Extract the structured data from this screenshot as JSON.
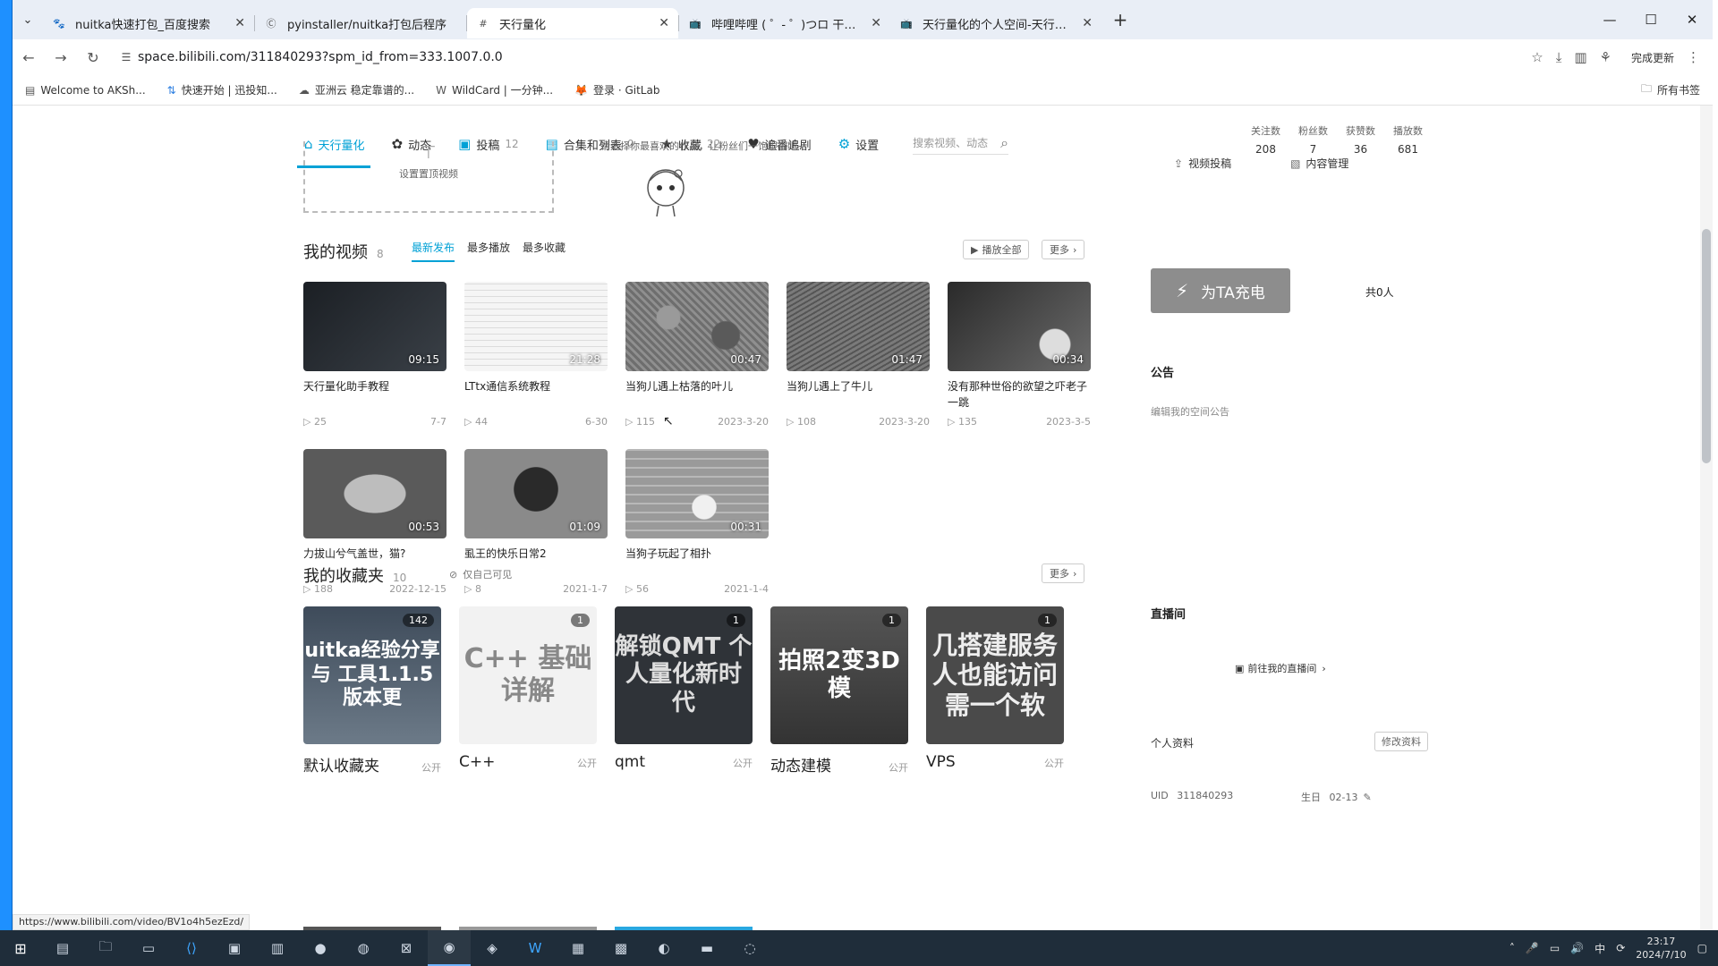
{
  "browser": {
    "tabs": [
      {
        "title": "nuitka快速打包_百度搜索",
        "icon": "paw-icon",
        "active": false
      },
      {
        "title": "pyinstaller/nuitka打包后程序",
        "icon": "c-icon",
        "active": false
      },
      {
        "title": "天行量化",
        "icon": "hash-icon",
        "active": true
      },
      {
        "title": "哔哩哔哩 ( ゜- ゜)つロ 干杯~-bi",
        "icon": "bilibili-icon",
        "active": false
      },
      {
        "title": "天行量化的个人空间-天行量化",
        "icon": "bilibili-icon",
        "active": false
      }
    ],
    "url": "space.bilibili.com/311840293?spm_id_from=333.1007.0.0",
    "update_label": "完成更新",
    "bookmarks": [
      "Welcome to AKSh...",
      "快速开始 | 迅投知...",
      "亚洲云 稳定靠谱的...",
      "WildCard | 一分钟...",
      "登录 · GitLab"
    ],
    "all_bookmarks": "所有书签"
  },
  "space": {
    "nav": [
      {
        "label": "天行量化",
        "count": "",
        "icon": "home-icon",
        "active": true
      },
      {
        "label": "动态",
        "count": "",
        "icon": "dynamic-icon"
      },
      {
        "label": "投稿",
        "count": "12",
        "icon": "upload-icon"
      },
      {
        "label": "合集和列表",
        "count": "0",
        "icon": "collection-icon"
      },
      {
        "label": "收藏",
        "count": "22",
        "icon": "favorite-icon"
      },
      {
        "label": "追番追剧",
        "count": "",
        "icon": "heart-icon"
      },
      {
        "label": "设置",
        "count": "",
        "icon": "gear-icon"
      }
    ],
    "search_placeholder": "搜索视频、动态",
    "stats": [
      {
        "label": "关注数",
        "value": "208"
      },
      {
        "label": "粉丝数",
        "value": "7"
      },
      {
        "label": "获赞数",
        "value": "36"
      },
      {
        "label": "播放数",
        "value": "681"
      }
    ],
    "top_video_label": "设置置顶视频",
    "top_hint": "请选择你最喜欢的作品，让粉丝们一饱眼福吧~",
    "right_links": [
      "视频投稿",
      "内容管理"
    ],
    "charge_label": "为TA充电",
    "charge_count": "共0人",
    "notice_title": "公告",
    "notice_text": "编辑我的空间公告",
    "live_title": "直播间",
    "live_link": "前往我的直播间",
    "profile_title": "个人资料",
    "profile_edit": "修改资料",
    "uid_label": "UID",
    "uid": "311840293",
    "birthday_label": "生日",
    "birthday": "02-13"
  },
  "videos_section": {
    "title": "我的视频",
    "count": "8",
    "sorts": [
      "最新发布",
      "最多播放",
      "最多收藏"
    ],
    "play_all": "播放全部",
    "more": "更多",
    "videos": [
      {
        "title": "天行量化助手教程",
        "duration": "09:15",
        "plays": "25",
        "date": "7-7"
      },
      {
        "title": "LTtx通信系统教程",
        "duration": "21:28",
        "plays": "44",
        "date": "6-30"
      },
      {
        "title": "当狗儿遇上枯落的叶儿",
        "duration": "00:47",
        "plays": "115",
        "date": "2023-3-20"
      },
      {
        "title": "当狗儿遇上了牛儿",
        "duration": "01:47",
        "plays": "108",
        "date": "2023-3-20"
      },
      {
        "title": "没有那种世俗的欲望之吓老子一跳",
        "duration": "00:34",
        "plays": "135",
        "date": "2023-3-5"
      },
      {
        "title": "力拔山兮气盖世，猫?",
        "duration": "00:53",
        "plays": "188",
        "date": "2022-12-15"
      },
      {
        "title": "虱王的快乐日常2",
        "duration": "01:09",
        "plays": "8",
        "date": "2021-1-7"
      },
      {
        "title": "当狗子玩起了相扑",
        "duration": "00:31",
        "plays": "56",
        "date": "2021-1-4"
      }
    ]
  },
  "favs_section": {
    "title": "我的收藏夹",
    "count": "10",
    "privacy": "仅自己可见",
    "more": "更多",
    "folders": [
      {
        "name": "默认收藏夹",
        "count": "142",
        "visibility": "公开",
        "cover_text": "uitka经验分享 与 工具1.1.5版本更"
      },
      {
        "name": "C++",
        "count": "1",
        "visibility": "公开",
        "cover_text": "C++ 基础详解"
      },
      {
        "name": "qmt",
        "count": "1",
        "visibility": "公开",
        "cover_text": "解锁QMT 个人量化新时代"
      },
      {
        "name": "动态建模",
        "count": "1",
        "visibility": "公开",
        "cover_text": "拍照2变3D模"
      },
      {
        "name": "VPS",
        "count": "1",
        "visibility": "公开",
        "cover_text": "几搭建服务 人也能访问 需一个软"
      }
    ]
  },
  "status_url": "https://www.bilibili.com/video/BV1o4h5ezEzd/",
  "taskbar": {
    "time": "23:17",
    "date": "2024/7/10",
    "ime": "中"
  }
}
